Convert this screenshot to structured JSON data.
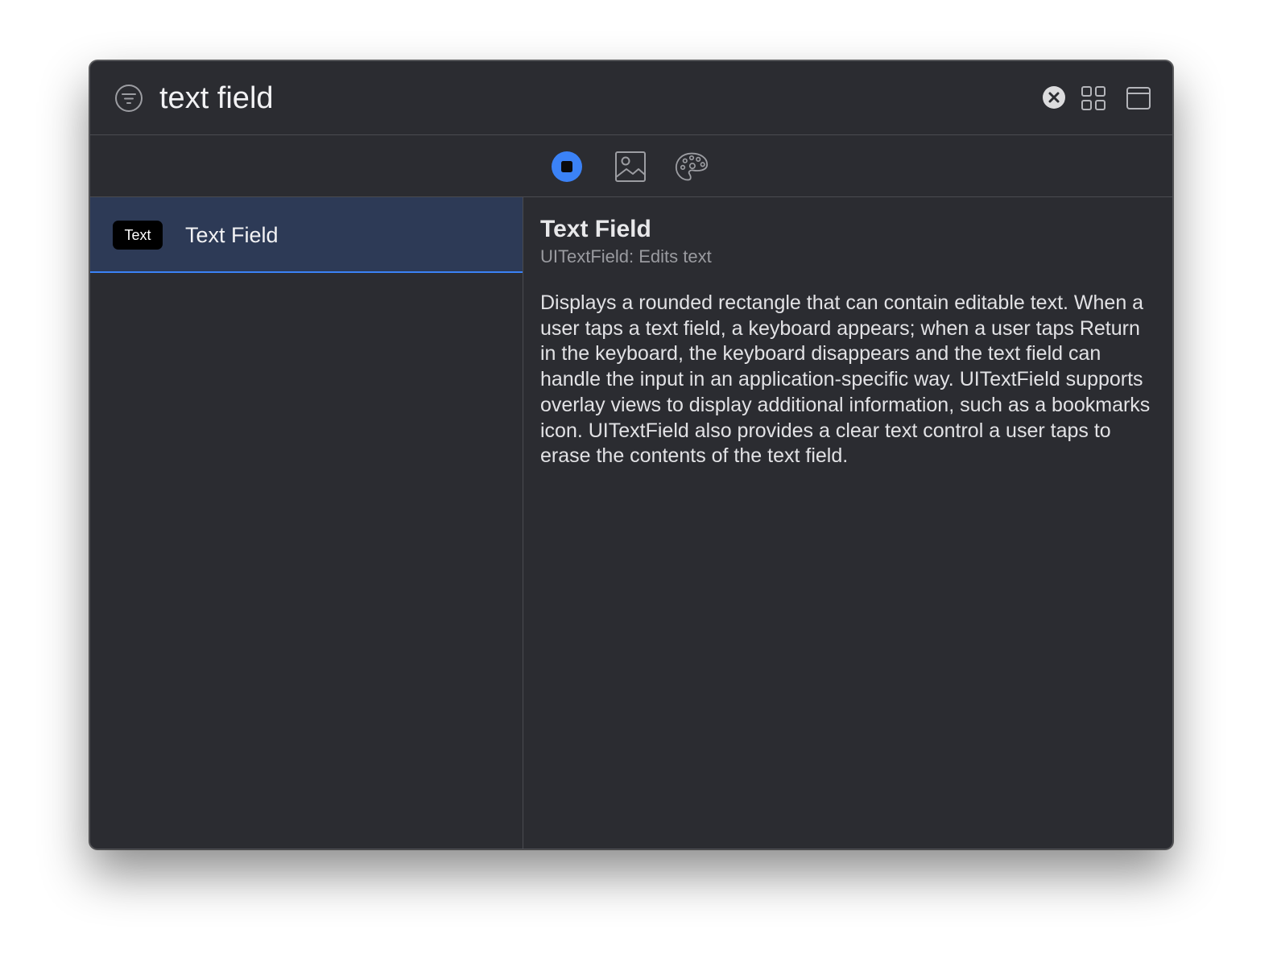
{
  "search": {
    "value": "text field",
    "filter_icon": "filter-icon",
    "clear_icon": "clear-circle-icon"
  },
  "toolbar": {
    "grid_icon": "grid-icon",
    "panel_icon": "panel-icon"
  },
  "tabs": [
    {
      "icon": "objects-icon",
      "selected": true
    },
    {
      "icon": "image-icon",
      "selected": false
    },
    {
      "icon": "palette-icon",
      "selected": false
    }
  ],
  "results": [
    {
      "badge": "Text",
      "label": "Text Field",
      "selected": true
    }
  ],
  "detail": {
    "title": "Text Field",
    "subtitle": "UITextField: Edits text",
    "description": "Displays a rounded rectangle that can contain editable text. When a user taps a text field, a keyboard appears; when a user taps Return in the keyboard, the keyboard disappears and the text field can handle the input in an application-specific way. UITextField supports overlay views to display additional information, such as a bookmarks icon. UITextField also provides a clear text control a user taps to erase the contents of the text field."
  },
  "colors": {
    "window_bg": "#2b2c31",
    "selection_bg": "#2d3a56",
    "accent": "#3b82f6"
  }
}
